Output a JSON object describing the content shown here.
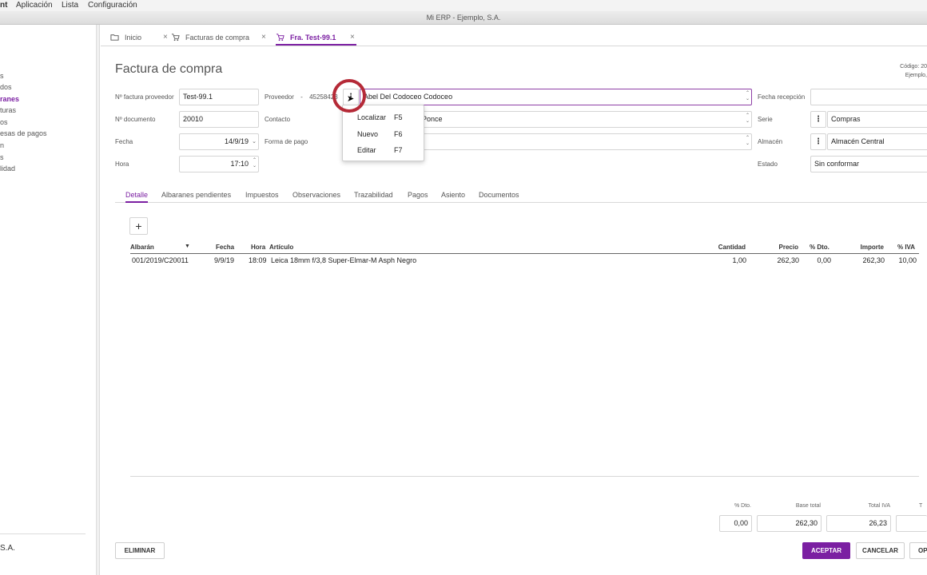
{
  "menubar": {
    "app": "nt",
    "items": [
      "Aplicación",
      "Lista",
      "Configuración"
    ]
  },
  "window_title": "Mi ERP - Ejemplo, S.A.",
  "sidebar": {
    "items": [
      {
        "label": "s"
      },
      {
        "label": "dos"
      },
      {
        "label": "ranes",
        "active": true
      },
      {
        "label": "turas"
      },
      {
        "label": "os"
      },
      {
        "label": "esas de pagos"
      },
      {
        "label": "n"
      },
      {
        "label": "s"
      },
      {
        "label": "lidad"
      }
    ],
    "company": "S.A."
  },
  "tabs": [
    {
      "label": "Inicio",
      "icon": "folder-icon"
    },
    {
      "label": "Facturas de compra",
      "icon": "cart-icon"
    },
    {
      "label": "Fra. Test-99.1",
      "icon": "cart-icon",
      "active": true
    }
  ],
  "close_glyph": "×",
  "page": {
    "title": "Factura de compra",
    "codigo_line1": "Código: 20",
    "codigo_line2": "Ejemplo,"
  },
  "form": {
    "n_factura_label": "Nº factura proveedor",
    "n_factura_value": "Test-99.1",
    "n_documento_label": "Nº documento",
    "n_documento_value": "20010",
    "fecha_label": "Fecha",
    "fecha_value": "14/9/19",
    "hora_label": "Hora",
    "hora_value": "17:10",
    "proveedor_label": "Proveedor",
    "proveedor_dash": "-",
    "proveedor_code": "45258423",
    "proveedor_value": "Abel Del Codoceo Codoceo",
    "contacto_label": "Contacto",
    "contacto_value": "Ponce",
    "forma_pago_label": "Forma de pago",
    "forma_pago_value": "",
    "fecha_recepcion_label": "Fecha recepción",
    "fecha_recepcion_value": "",
    "serie_label": "Serie",
    "serie_value": "Compras",
    "almacen_label": "Almacén",
    "almacen_value": "Almacén Central",
    "estado_label": "Estado",
    "estado_value": "Sin conformar"
  },
  "context_menu": [
    {
      "label": "Localizar",
      "key": "F5"
    },
    {
      "label": "Nuevo",
      "key": "F6"
    },
    {
      "label": "Editar",
      "key": "F7"
    }
  ],
  "subtabs": [
    "Detalle",
    "Albaranes pendientes",
    "Impuestos",
    "Observaciones",
    "Trazabilidad",
    "Pagos",
    "Asiento",
    "Documentos"
  ],
  "add_label": "+",
  "table": {
    "headers": {
      "albaran": "Albarán",
      "fecha": "Fecha",
      "hora": "Hora",
      "articulo": "Artículo",
      "cantidad": "Cantidad",
      "precio": "Precio",
      "dto": "% Dto.",
      "importe": "Importe",
      "iva": "% IVA"
    },
    "rows": [
      {
        "albaran": "001/2019/C20011",
        "fecha": "9/9/19",
        "hora": "18:09",
        "articulo": "Leica 18mm f/3,8 Super-Elmar-M Asph Negro",
        "cantidad": "1,00",
        "precio": "262,30",
        "dto": "0,00",
        "importe": "262,30",
        "iva": "10,00"
      }
    ]
  },
  "totals": {
    "dto_label": "% Dto.",
    "dto_value": "0,00",
    "base_label": "Base total",
    "base_value": "262,30",
    "iva_label": "Total IVA",
    "iva_value": "26,23",
    "total_label": "T",
    "total_value": ""
  },
  "buttons": {
    "eliminar": "ELIMINAR",
    "aceptar": "ACEPTAR",
    "cancelar": "CANCELAR",
    "op": "OP"
  },
  "colors": {
    "accent": "#7b1fa2",
    "highlight_ring": "#b52a37"
  }
}
